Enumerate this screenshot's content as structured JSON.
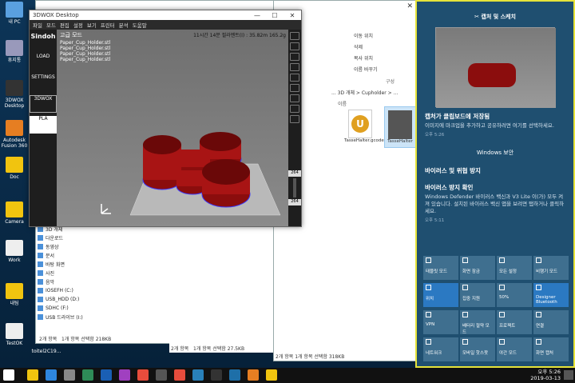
{
  "desktop_icons": [
    {
      "label": "내 PC",
      "name": "this-pc-icon"
    },
    {
      "label": "휴지통",
      "name": "recycle-bin-icon"
    },
    {
      "label": "3DWOX Desktop",
      "name": "3dwox-app-icon"
    },
    {
      "label": "Autodesk Fusion 360",
      "name": "fusion360-app-icon"
    },
    {
      "label": "Doc",
      "name": "doc-folder-icon"
    },
    {
      "label": "Camera",
      "name": "camera-folder-icon"
    },
    {
      "label": "Work",
      "name": "work-folder-icon"
    },
    {
      "label": "내팀",
      "name": "team-folder-icon"
    },
    {
      "label": "TestOK",
      "name": "testok-file-icon"
    }
  ],
  "extra_label": "toitel2C19...",
  "explorer_back": {
    "title": "files",
    "nav": [
      {
        "label": "3D 개체",
        "icon": "3d-objects-icon"
      },
      {
        "label": "다운로드",
        "icon": "download-icon"
      },
      {
        "label": "동영상",
        "icon": "video-icon"
      },
      {
        "label": "문서",
        "icon": "document-icon"
      },
      {
        "label": "바탕 화면",
        "icon": "desktop-icon"
      },
      {
        "label": "사진",
        "icon": "pictures-icon"
      },
      {
        "label": "음악",
        "icon": "music-icon"
      },
      {
        "label": "IOSEFH (C:)",
        "icon": "drive-icon"
      },
      {
        "label": "USB_HDD (D:)",
        "icon": "drive-icon"
      },
      {
        "label": "SDHC (F:)",
        "icon": "drive-icon"
      },
      {
        "label": "USB 드라이브 (I:)",
        "icon": "drive-icon"
      }
    ],
    "status_left": "2개 항목",
    "status_mid": "1개 항목 선택함 218KB",
    "status2_left": "2개 항목",
    "status2_mid": "1개 항목 선택함 27.5KB"
  },
  "explorer_mid": {
    "toolbar": [
      "이동 위치",
      "삭제",
      "복사 위치",
      "이름 바꾸기"
    ],
    "group": "구성",
    "crumb": "... 3D 개체 > Cupholder > ...",
    "files": [
      {
        "label": "TasseHalter.gcode"
      },
      {
        "label": "TasseHalter"
      }
    ],
    "sub": "이름",
    "status": "2개 항목 1개 항목 선택함 318KB"
  },
  "sindoh": {
    "title": "3DWOX Desktop",
    "menu": [
      "파일",
      "모드",
      "편집",
      "설정",
      "보기",
      "프린터",
      "분석",
      "도움말"
    ],
    "left": [
      "Sindoh",
      "LOAD",
      "SETTINGS",
      "3DWOX",
      "PLA"
    ],
    "model_list_title": "고급 모드",
    "models": [
      "Paper_Cup_Holder.stl",
      "Paper_Cup_Holder.stl",
      "Paper_Cup_Holder.stl",
      "Paper_Cup_Holder.stl"
    ],
    "info": "11시간 14분  필라멘트(I) : 35.82m  165.2g",
    "layer_top": "264",
    "layer_low": "264"
  },
  "action_center": {
    "header": "캡처 및 스케치",
    "notif1_title": "캡처가 클립보드에 저장됨",
    "notif1_body": "이미지에 마크업을 추가하고 공유하려면 여기를 선택하세요.",
    "notif1_time": "오후 5:26",
    "section": "Windows 보안",
    "notif2_title": "바이러스 및 위협 방지",
    "notif3_title": "바이러스 방지 확인",
    "notif3_body": "Windows Defender 바이러스 백신과 V3 Lite 이(가) 모두 켜져 있습니다. 설치된 바이러스 백신 앱을 보려면 탭하거나 클릭하세요.",
    "notif3_time": "오후 5:11",
    "tiles": [
      {
        "label": "태블릿 모드",
        "on": false,
        "icon": "tablet-icon"
      },
      {
        "label": "화면 잠금",
        "on": false,
        "icon": "rotation-lock-icon"
      },
      {
        "label": "모든 설정",
        "on": false,
        "icon": "gear-icon"
      },
      {
        "label": "비행기 모드",
        "on": false,
        "icon": "airplane-icon"
      },
      {
        "label": "위치",
        "on": true,
        "icon": "location-icon"
      },
      {
        "label": "집중 지원",
        "on": false,
        "icon": "moon-icon"
      },
      {
        "label": "50%",
        "on": false,
        "icon": "brightness-icon"
      },
      {
        "label": "Designer Bluetooth",
        "on": true,
        "icon": "bluetooth-icon"
      },
      {
        "label": "VPN",
        "on": false,
        "icon": "vpn-icon"
      },
      {
        "label": "배터리 절약 모드",
        "on": false,
        "icon": "battery-icon"
      },
      {
        "label": "프로젝트",
        "on": false,
        "icon": "project-icon"
      },
      {
        "label": "연결",
        "on": false,
        "icon": "connect-icon"
      },
      {
        "label": "네트워크",
        "on": false,
        "icon": "network-icon"
      },
      {
        "label": "모바일 핫스팟",
        "on": false,
        "icon": "hotspot-icon"
      },
      {
        "label": "야간 모드",
        "on": false,
        "icon": "night-light-icon"
      },
      {
        "label": "화면 캡처",
        "on": false,
        "icon": "snip-icon"
      }
    ]
  },
  "taskbar": {
    "time": "오후 5:26",
    "date": "2019-03-13"
  },
  "colors": {
    "accent": "#e6e33a",
    "ac_bg": "#1f4f70",
    "tile_on": "#2b79c2",
    "model": "#8b0d0d"
  }
}
